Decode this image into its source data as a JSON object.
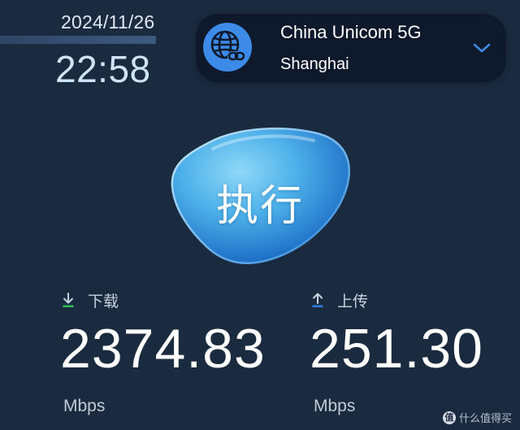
{
  "header": {
    "date": "2024/11/26",
    "time": "22:58"
  },
  "server": {
    "name": "China Unicom 5G",
    "city": "Shanghai",
    "icon": "globe-link-icon"
  },
  "action": {
    "label": "执行"
  },
  "download": {
    "label": "下载",
    "value": "2374.83",
    "unit": "Mbps",
    "icon": "download-arrow-icon",
    "icon_color": "#2fbf5a"
  },
  "upload": {
    "label": "上传",
    "value": "251.30",
    "unit": "Mbps",
    "icon": "upload-arrow-icon",
    "icon_color": "#2f7fe0"
  },
  "watermark": {
    "text": "什么值得买",
    "mark": "值"
  },
  "colors": {
    "background": "#1a2a3f",
    "card": "#0e1a2b",
    "accent": "#3d8be8"
  }
}
